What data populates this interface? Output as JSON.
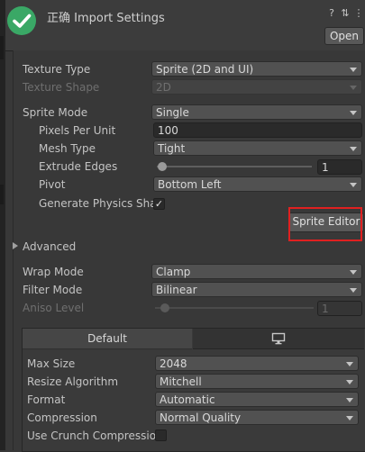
{
  "header": {
    "title": "正确 Import Settings",
    "open_label": "Open",
    "help_icon": "?",
    "settings_icon": "⇅",
    "menu_icon": "⋮"
  },
  "texture": {
    "texture_type_label": "Texture Type",
    "texture_type_value": "Sprite (2D and UI)",
    "texture_shape_label": "Texture Shape",
    "texture_shape_value": "2D"
  },
  "sprite": {
    "mode_label": "Sprite Mode",
    "mode_value": "Single",
    "ppu_label": "Pixels Per Unit",
    "ppu_value": "100",
    "mesh_label": "Mesh Type",
    "mesh_value": "Tight",
    "extrude_label": "Extrude Edges",
    "extrude_value": "1",
    "pivot_label": "Pivot",
    "pivot_value": "Bottom Left",
    "physics_label": "Generate Physics Sha",
    "physics_checked": "✓",
    "editor_button": "Sprite Editor"
  },
  "advanced": {
    "label": "Advanced"
  },
  "wrap": {
    "wrap_label": "Wrap Mode",
    "wrap_value": "Clamp",
    "filter_label": "Filter Mode",
    "filter_value": "Bilinear",
    "aniso_label": "Aniso Level",
    "aniso_value": "1"
  },
  "platform": {
    "tab_default": "Default",
    "max_size_label": "Max Size",
    "max_size_value": "2048",
    "resize_label": "Resize Algorithm",
    "resize_value": "Mitchell",
    "format_label": "Format",
    "format_value": "Automatic",
    "compression_label": "Compression",
    "compression_value": "Normal Quality",
    "crunch_label": "Use Crunch Compression"
  },
  "colors": {
    "success_green": "#3aa866",
    "highlight_red": "#e02020",
    "background": "#383838"
  }
}
